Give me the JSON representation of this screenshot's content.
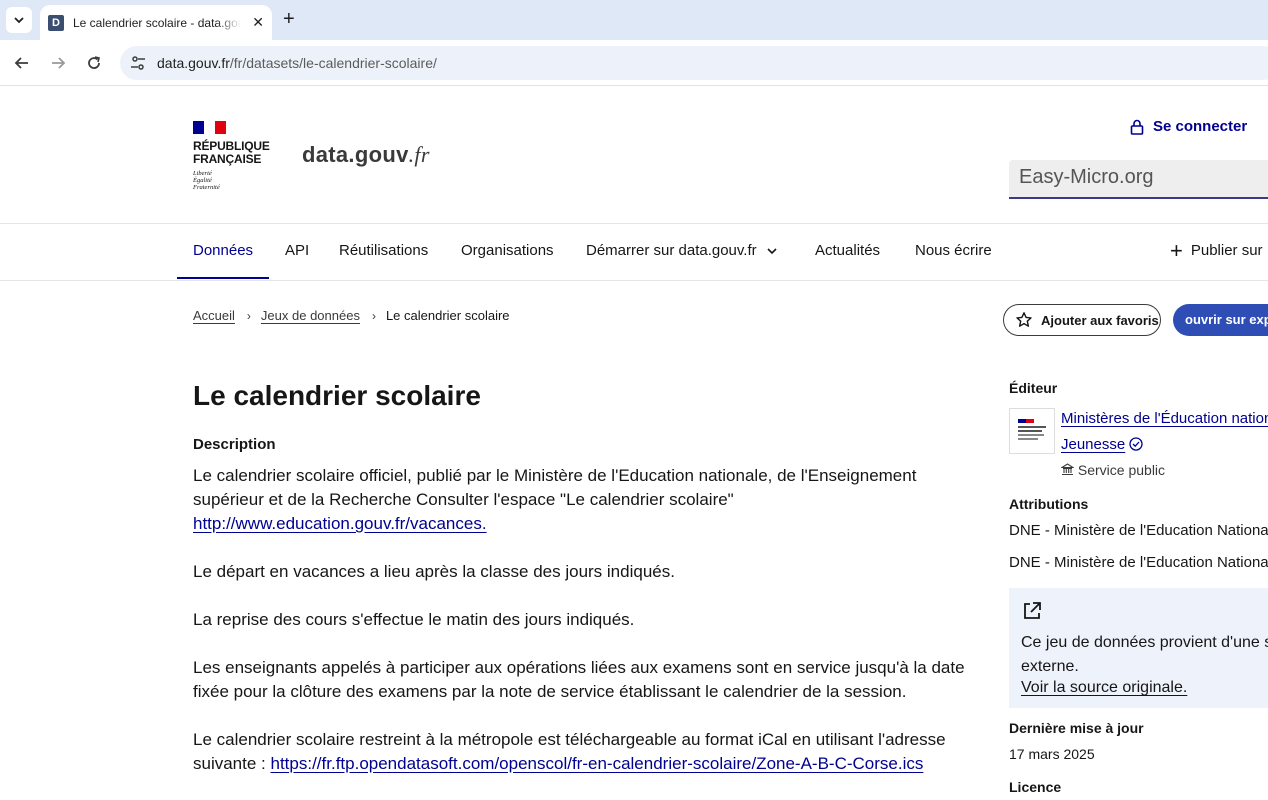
{
  "browser": {
    "tab_title": "Le calendrier scolaire - data.gouv.fr",
    "favicon_letter": "D",
    "url_host": "data.gouv.fr",
    "url_path": "/fr/datasets/le-calendrier-scolaire/"
  },
  "header": {
    "rf_line1": "RÉPUBLIQUE",
    "rf_line2": "FRANÇAISE",
    "devise": [
      "Liberté",
      "Égalité",
      "Fraternité"
    ],
    "brand_main": "data.gouv",
    "brand_suffix": ".fr",
    "login_label": "Se connecter",
    "search_value": "Easy-Micro.org"
  },
  "nav": {
    "items": [
      "Données",
      "API",
      "Réutilisations",
      "Organisations",
      "Démarrer sur data.gouv.fr",
      "Actualités",
      "Nous écrire"
    ],
    "publish_label": "Publier sur"
  },
  "breadcrumb": {
    "home": "Accueil",
    "datasets": "Jeux de données",
    "current": "Le calendrier scolaire"
  },
  "actions": {
    "favorite_label": "Ajouter aux favoris",
    "explore_label": "ouvrir sur explore"
  },
  "dataset": {
    "title": "Le calendrier scolaire",
    "description_label": "Description",
    "p1": "Le calendrier scolaire officiel, publié par le Ministère de l'Education nationale, de l'Enseignement supérieur et de la Recherche Consulter l'espace \"Le calendrier scolaire\"",
    "p1_link": "http://www.education.gouv.fr/vacances.",
    "p2": "Le départ en vacances a lieu après la classe des jours indiqués.",
    "p3": "La reprise des cours s'effectue le matin des jours indiqués.",
    "p4": "Les enseignants appelés à participer aux opérations liées aux examens sont en service jusqu'à la date fixée pour la clôture des examens par la note de service établissant le calendrier de la session.",
    "p5": "Le calendrier scolaire restreint à la métropole est téléchargeable au format iCal en utilisant l'adresse suivante :",
    "p5_link": "https://fr.ftp.opendatasoft.com/openscol/fr-en-calendrier-scolaire/Zone-A-B-C-Corse.ics"
  },
  "sidebar": {
    "editor_heading": "Éditeur",
    "editor_line1": "Ministères de l'Éducation nationale",
    "editor_line2": "Jeunesse",
    "editor_type": "Service public",
    "attributions_heading": "Attributions",
    "attribution1": "DNE - Ministère de l'Education Nationale",
    "attribution2": "DNE - Ministère de l'Education Nationale",
    "external_line1": "Ce jeu de données provient d'une source",
    "external_line2": "externe.",
    "external_link": "Voir la source originale.",
    "updated_heading": "Dernière mise à jour",
    "updated_value": "17 mars 2025",
    "license_heading": "Licence"
  }
}
